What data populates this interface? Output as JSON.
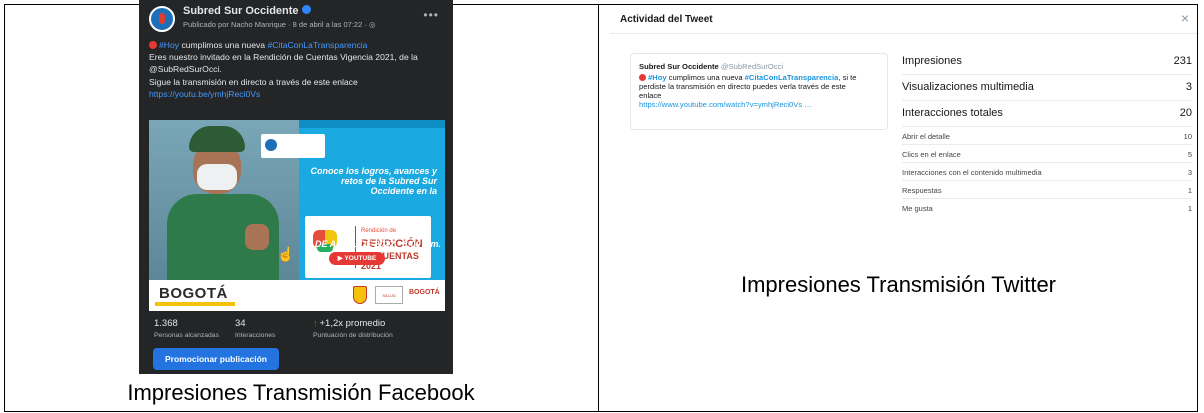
{
  "facebook": {
    "page_name": "Subred Sur Occidente",
    "meta": "Publicado por Nacho Manrique · 8 de abril a las 07:22 ·",
    "post_lines": [
      {
        "hash": "#Hoy",
        "text": " cumplimos una nueva ",
        "hash2": "#CitaConLaTransparencia"
      },
      {
        "text": "Eres nuestro invitado en la Rendición de Cuentas Vigencia 2021, de la"
      },
      {
        "text": "@SubRedSurOcci."
      },
      {
        "text": "Sigue la transmisión en directo a través de este enlace"
      }
    ],
    "link": "https://youtu.be/ymhjReci0Vs",
    "image": {
      "headline": "Conoce los logros, avances y retos de la Subred Sur Occidente en la",
      "rendicion_sub": "Rendición de",
      "rendicion_big": "RENDICIÓN",
      "rendicion_cc": "DE CUENTAS 2021",
      "date": "8 DE ABRIL DE 2022 - 8:00 a.m.",
      "youtube": "YOUTUBE",
      "sigue": "Sigue nuestra transmisión en Subred Sur Occidente",
      "bogota": "BOGOTÁ",
      "salud": "SALUD",
      "bogota_small": "BOGOTÁ"
    },
    "stats": [
      {
        "value": "1.368",
        "label": "Personas alcanzadas"
      },
      {
        "value": "34",
        "label": "Interacciones"
      },
      {
        "value": "+1,2x promedio",
        "label": "Puntuación de distribución"
      }
    ],
    "promote_label": "Promocionar publicación",
    "caption": "Impresiones Transmisión Facebook"
  },
  "twitter": {
    "title": "Actividad del Tweet",
    "close": "×",
    "tweet": {
      "name": "Subred Sur Occidente",
      "handle": "@SubRedSurOcci",
      "line1_hash": "#Hoy",
      "line1_text": " cumplimos una nueva ",
      "line1_hash2": "#CitaConLaTransparencia",
      "line1_tail": ", si te",
      "line2": "perdiste la transmisión en directo puedes verla través de este",
      "line3": "enlace",
      "link": "https://www.youtube.com/watch?v=ymhjReci0Vs …"
    },
    "metrics": [
      {
        "label": "Impresiones",
        "value": "231"
      },
      {
        "label": "Visualizaciones multimedia",
        "value": "3"
      },
      {
        "label": "Interacciones totales",
        "value": "20"
      }
    ],
    "details": [
      {
        "label": "Abrir el detalle",
        "value": "10"
      },
      {
        "label": "Clics en el enlace",
        "value": "5"
      },
      {
        "label": "Interacciones con el contenido multimedia",
        "value": "3"
      },
      {
        "label": "Respuestas",
        "value": "1"
      },
      {
        "label": "Me gusta",
        "value": "1"
      }
    ],
    "caption": "Impresiones Transmisión Twitter"
  },
  "colors": {
    "fb_bg": "#242526",
    "fb_link": "#4599ff",
    "fb_button": "#2374e1",
    "tw_link": "#1b95e0"
  }
}
